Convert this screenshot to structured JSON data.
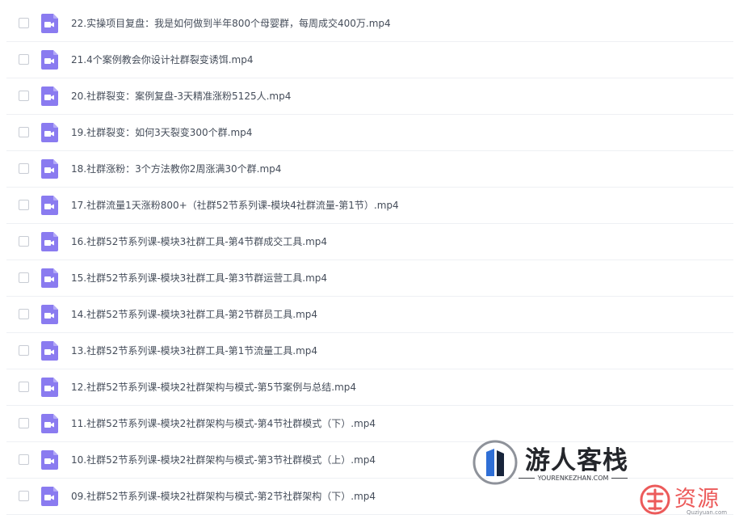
{
  "file_list": {
    "items": [
      {
        "name": "22.实操项目复盘：我是如何做到半年800个母婴群，每周成交400万.mp4",
        "icon": "video-file-icon",
        "checked": false
      },
      {
        "name": "21.4个案例教会你设计社群裂变诱饵.mp4",
        "icon": "video-file-icon",
        "checked": false
      },
      {
        "name": "20.社群裂变：案例复盘-3天精准涨粉5125人.mp4",
        "icon": "video-file-icon",
        "checked": false
      },
      {
        "name": "19.社群裂变：如何3天裂变300个群.mp4",
        "icon": "video-file-icon",
        "checked": false
      },
      {
        "name": "18.社群涨粉：3个方法教你2周涨满30个群.mp4",
        "icon": "video-file-icon",
        "checked": false
      },
      {
        "name": "17.社群流量1天涨粉800+（社群52节系列课-模块4社群流量-第1节）.mp4",
        "icon": "video-file-icon",
        "checked": false
      },
      {
        "name": "16.社群52节系列课-模块3社群工具-第4节群成交工具.mp4",
        "icon": "video-file-icon",
        "checked": false
      },
      {
        "name": "15.社群52节系列课-模块3社群工具-第3节群运营工具.mp4",
        "icon": "video-file-icon",
        "checked": false
      },
      {
        "name": "14.社群52节系列课-模块3社群工具-第2节群员工具.mp4",
        "icon": "video-file-icon",
        "checked": false
      },
      {
        "name": "13.社群52节系列课-模块3社群工具-第1节流量工具.mp4",
        "icon": "video-file-icon",
        "checked": false
      },
      {
        "name": "12.社群52节系列课-模块2社群架构与模式-第5节案例与总结.mp4",
        "icon": "video-file-icon",
        "checked": false
      },
      {
        "name": "11.社群52节系列课-模块2社群架构与模式-第4节社群模式（下）.mp4",
        "icon": "video-file-icon",
        "checked": false
      },
      {
        "name": "10.社群52节系列课-模块2社群架构与模式-第3节社群模式（上）.mp4",
        "icon": "video-file-icon",
        "checked": false
      },
      {
        "name": "09.社群52节系列课-模块2社群架构与模式-第2节社群架构（下）.mp4",
        "icon": "video-file-icon",
        "checked": false
      }
    ]
  },
  "watermark": {
    "title": "游人客栈",
    "subtitle": "YOURENKEZHAN.COM",
    "title2": "资源",
    "subtitle2": "Quziyuan.com",
    "logo_icon": "youren-logo-icon",
    "logo2_icon": "qu-logo-icon"
  },
  "colors": {
    "video_icon": "#8a7bf0",
    "text": "#454d5a",
    "divider": "#eef0f4",
    "watermark_red": "#ec5a5a",
    "logo_blue": "#2f6fd6"
  }
}
